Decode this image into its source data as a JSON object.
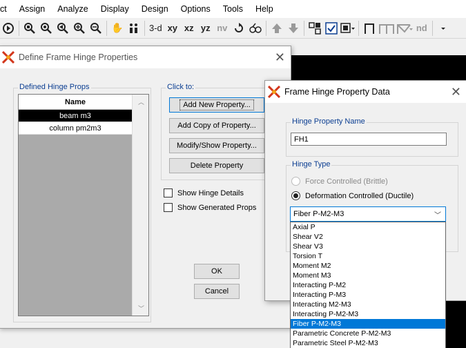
{
  "menubar": {
    "items": [
      "ct",
      "Assign",
      "Analyze",
      "Display",
      "Design",
      "Options",
      "Tools",
      "Help"
    ]
  },
  "toolbar": {
    "view_3d": "3-d",
    "plane_xy": "xy",
    "plane_xz": "xz",
    "plane_yz": "yz",
    "plane_nv": "nv",
    "nd": "nd"
  },
  "define_dialog": {
    "title": "Define Frame Hinge Properties",
    "defined_group_label": "Defined Hinge Props",
    "list_header": "Name",
    "list_items": [
      "beam m3",
      "column pm2m3"
    ],
    "selected_item": "beam m3",
    "click_to_label": "Click to:",
    "btn_add_new": "Add New Property...",
    "btn_add_copy": "Add Copy of Property...",
    "btn_modify": "Modify/Show Property...",
    "btn_delete": "Delete Property",
    "chk_show_hinge_details": "Show Hinge Details",
    "chk_show_generated": "Show Generated Props",
    "btn_ok": "OK",
    "btn_cancel": "Cancel"
  },
  "data_dialog": {
    "title": "Frame Hinge Property Data",
    "name_group_label": "Hinge Property Name",
    "name_value": "FH1",
    "type_group_label": "Hinge Type",
    "radio_force": "Force Controlled  (Brittle)",
    "radio_deformation": "Deformation Controlled  (Ductile)",
    "selected_type": "Fiber P-M2-M3",
    "options": [
      "Axial P",
      "Shear V2",
      "Shear V3",
      "Torsion T",
      "Moment M2",
      "Moment M3",
      "Interacting P-M2",
      "Interacting P-M3",
      "Interacting M2-M3",
      "Interacting P-M2-M3",
      "Fiber P-M2-M3",
      "Parametric Concrete P-M2-M3",
      "Parametric Steel P-M2-M3"
    ]
  },
  "colors": {
    "accent": "#0078d7",
    "group_label": "#0a3d91",
    "canvas": "#000000"
  }
}
